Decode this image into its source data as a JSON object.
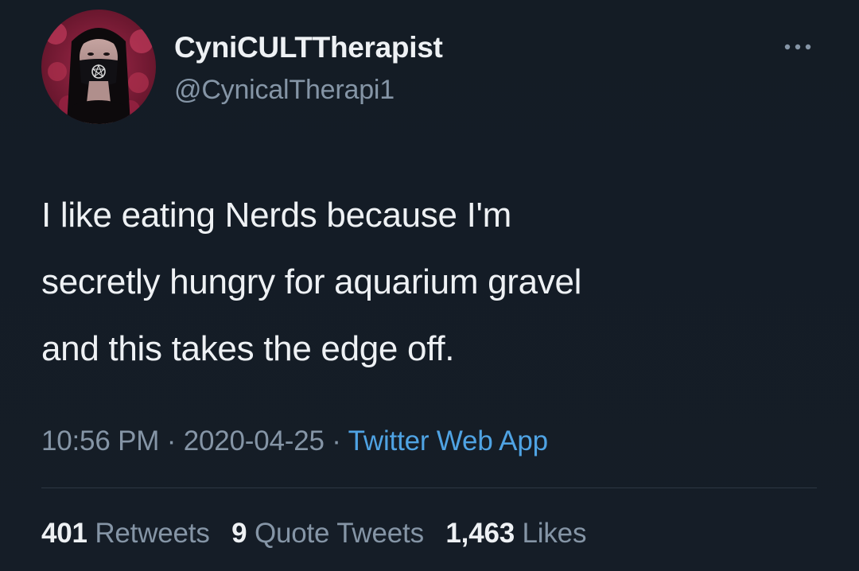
{
  "tweet": {
    "author": {
      "display_name": "CyniCULTTherapist",
      "handle": "@CynicalTherapi1",
      "avatar_icon": "user-avatar"
    },
    "more_icon": "more-options-icon",
    "text": "I like eating Nerds because I'm\nsecretly hungry for aquarium gravel\nand this takes the edge off.",
    "time": "10:56 PM",
    "separator": " · ",
    "date": "2020-04-25",
    "source": "Twitter Web App",
    "stats": {
      "retweets_count": "401",
      "retweets_label": "Retweets",
      "quotes_count": "9",
      "quotes_label": "Quote Tweets",
      "likes_count": "1,463",
      "likes_label": "Likes"
    }
  },
  "colors": {
    "background": "#151d27",
    "text_primary": "#eef1f4",
    "text_secondary": "#8595a6",
    "link": "#4fa3e3",
    "divider": "#2c3743"
  }
}
